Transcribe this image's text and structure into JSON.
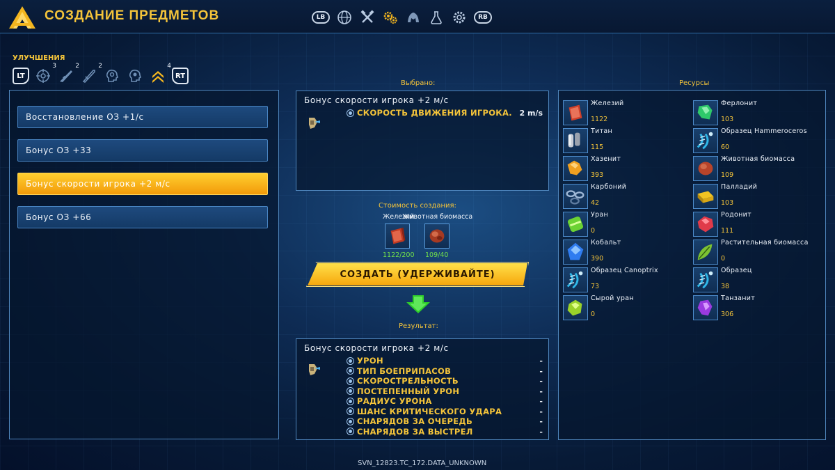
{
  "header": {
    "title": "СОЗДАНИЕ ПРЕДМЕТОВ",
    "lb": "LB",
    "rb": "RB",
    "nav_icons": [
      "globe-icon",
      "crossed-tools-icon",
      "gears-icon",
      "creature-icon",
      "flask-icon",
      "settings-gear-icon"
    ],
    "accent": "#f4c43a"
  },
  "upgrades": {
    "label": "УЛУЧШЕНИЯ",
    "lt": "LT",
    "rt": "RT",
    "icons": [
      {
        "name": "crosshair-icon",
        "count": "3"
      },
      {
        "name": "rifle-icon",
        "count": "2"
      },
      {
        "name": "blade-icon",
        "count": "2"
      },
      {
        "name": "head-icon",
        "count": ""
      },
      {
        "name": "head-alt-icon",
        "count": ""
      },
      {
        "name": "chevron-up-rank-icon",
        "count": "4"
      }
    ]
  },
  "recipes": [
    {
      "label": "Восстановление ОЗ +1/с"
    },
    {
      "label": "Бонус ОЗ +33"
    },
    {
      "label": "Бонус скорости игрока +2 м/с"
    },
    {
      "label": "Бонус ОЗ +66"
    }
  ],
  "selected": {
    "label": "Выбрано:",
    "title": "Бонус скорости игрока +2 м/с",
    "stat_name": "СКОРОСТЬ ДВИЖЕНИЯ ИГРОКА.",
    "stat_value": "2 m/s"
  },
  "cost": {
    "label": "Стоимость создания:",
    "items": [
      {
        "name": "Железий",
        "amount": "1122/200",
        "icon": "iron-ingot-icon"
      },
      {
        "name": "Животная биомасса",
        "amount": "109/40",
        "icon": "animal-biomass-icon"
      }
    ]
  },
  "create_button": "СОЗДАТЬ (УДЕРЖИВАЙТЕ)",
  "result": {
    "label": "Результат:",
    "title": "Бонус скорости игрока +2 м/с",
    "stats": [
      {
        "name": "УРОН",
        "value": "-"
      },
      {
        "name": "ТИП БОЕПРИПАСОВ",
        "value": "-"
      },
      {
        "name": "СКОРОСТРЕЛЬНОСТЬ",
        "value": "-"
      },
      {
        "name": "ПОСТЕПЕННЫЙ УРОН",
        "value": "-"
      },
      {
        "name": "РАДИУС УРОНА",
        "value": "-"
      },
      {
        "name": "ШАНС КРИТИЧЕСКОГО УДАРА",
        "value": "-"
      },
      {
        "name": "СНАРЯДОВ ЗА ОЧЕРЕДЬ",
        "value": "-"
      },
      {
        "name": "СНАРЯДОВ ЗА ВЫСТРЕЛ",
        "value": "-"
      }
    ]
  },
  "resources": {
    "label": "Ресурсы",
    "items": [
      {
        "name": "Железий",
        "count": "1122",
        "icon": "iron-ingot-icon",
        "color": "#d0402a"
      },
      {
        "name": "Ферлонит",
        "count": "103",
        "icon": "ferdonit-icon",
        "color": "#2ec96a"
      },
      {
        "name": "Титан",
        "count": "115",
        "icon": "titanium-icon",
        "color": "#c8cdd6"
      },
      {
        "name": "Образец Hammeroceros",
        "count": "60",
        "icon": "dna-icon",
        "color": "#2fb7e8"
      },
      {
        "name": "Хазенит",
        "count": "393",
        "icon": "hazenite-icon",
        "color": "#f0a020"
      },
      {
        "name": "Животная биомасса",
        "count": "109",
        "icon": "animal-biomass-icon",
        "color": "#b8442a"
      },
      {
        "name": "Карбоний",
        "count": "42",
        "icon": "carbonium-icon",
        "color": "#5f7ca0"
      },
      {
        "name": "Палладий",
        "count": "103",
        "icon": "palladium-icon",
        "color": "#f2c422"
      },
      {
        "name": "Уран",
        "count": "0",
        "icon": "uranium-icon",
        "color": "#6bd233"
      },
      {
        "name": "Родонит",
        "count": "111",
        "icon": "rhodonite-icon",
        "color": "#e03a4a"
      },
      {
        "name": "Кобальт",
        "count": "390",
        "icon": "cobalt-icon",
        "color": "#2f7cf0"
      },
      {
        "name": "Растительная биомасса",
        "count": "0",
        "icon": "plant-biomass-icon",
        "color": "#7cc233"
      },
      {
        "name": "Образец Canoptrix",
        "count": "73",
        "icon": "dna-icon",
        "color": "#2fb7e8"
      },
      {
        "name": "Образец",
        "count": "38",
        "icon": "dna-icon",
        "color": "#2fb7e8"
      },
      {
        "name": "Сырой уран",
        "count": "0",
        "icon": "raw-uranium-icon",
        "color": "#9ad22a"
      },
      {
        "name": "Танзанит",
        "count": "306",
        "icon": "tanzanite-icon",
        "color": "#9a3ae0"
      }
    ]
  },
  "footer": "SVN_12823.TC_172.DATA_UNKNOWN"
}
